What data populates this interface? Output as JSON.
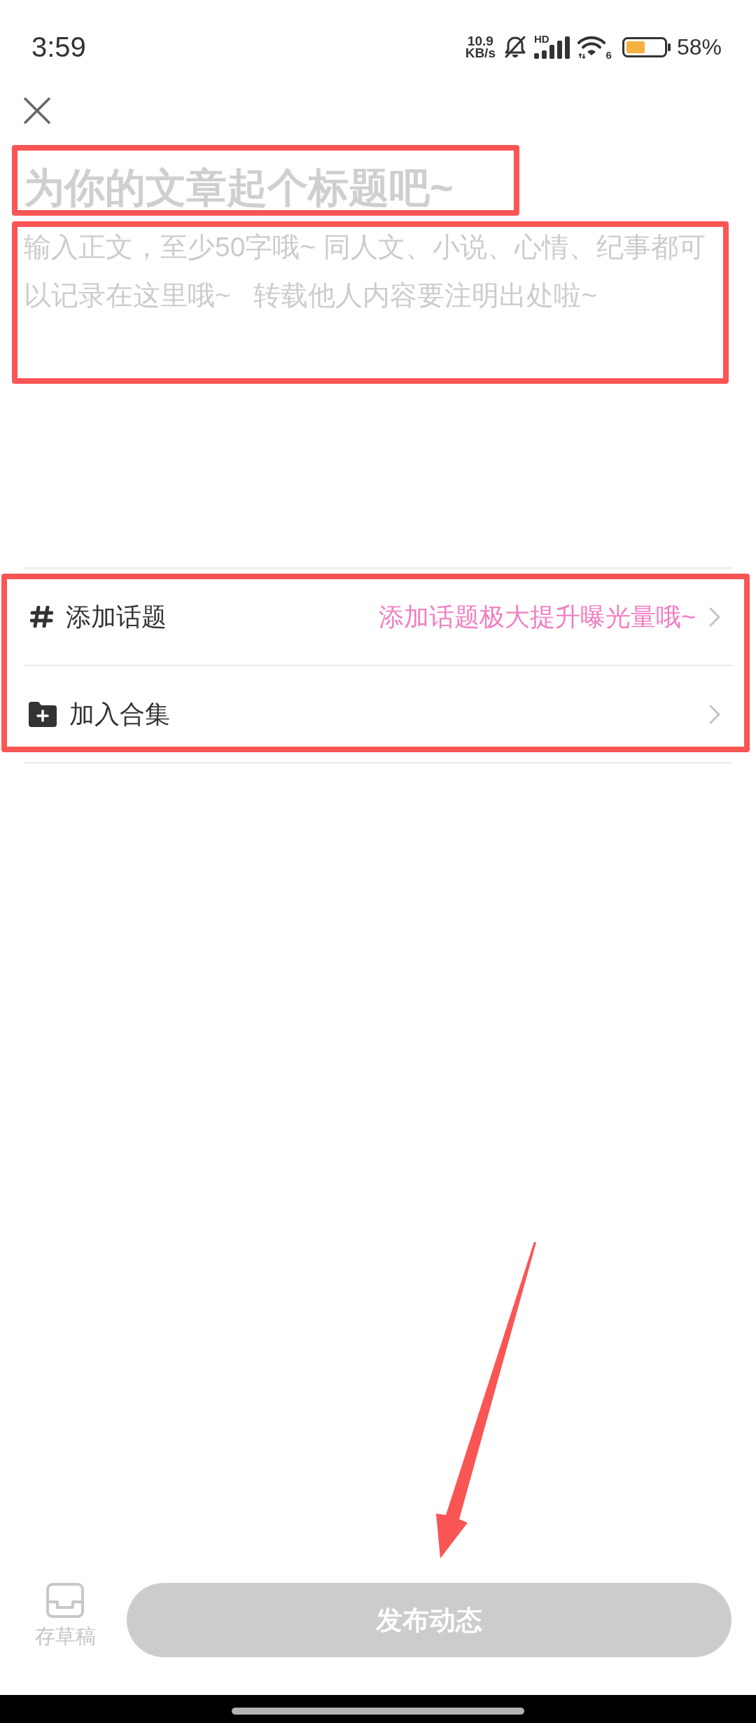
{
  "status_bar": {
    "time": "3:59",
    "speed_value": "10.9",
    "speed_unit": "KB/s",
    "signal_label": "HD",
    "wifi_label": "6",
    "battery": "58%"
  },
  "editor": {
    "title": {
      "placeholder": "为你的文章起个标题吧~"
    },
    "body": {
      "placeholder": "输入正文，至少50字哦~ 同人文、小说、心情、纪事都可以记录在这里哦~   转载他人内容要注明出处啦~"
    }
  },
  "options": [
    {
      "kind": "topic",
      "label": "添加话题",
      "hint": "添加话题极大提升曝光量哦~"
    },
    {
      "kind": "collection",
      "label": "加入合集"
    }
  ],
  "footer": {
    "draft_label": "存草稿",
    "publish_button": {
      "label": "发布动态",
      "disabled": true
    }
  },
  "annotations": [
    {
      "kind": "frame"
    },
    {
      "kind": "frame"
    },
    {
      "kind": "frame"
    },
    {
      "kind": "arrow"
    }
  ]
}
